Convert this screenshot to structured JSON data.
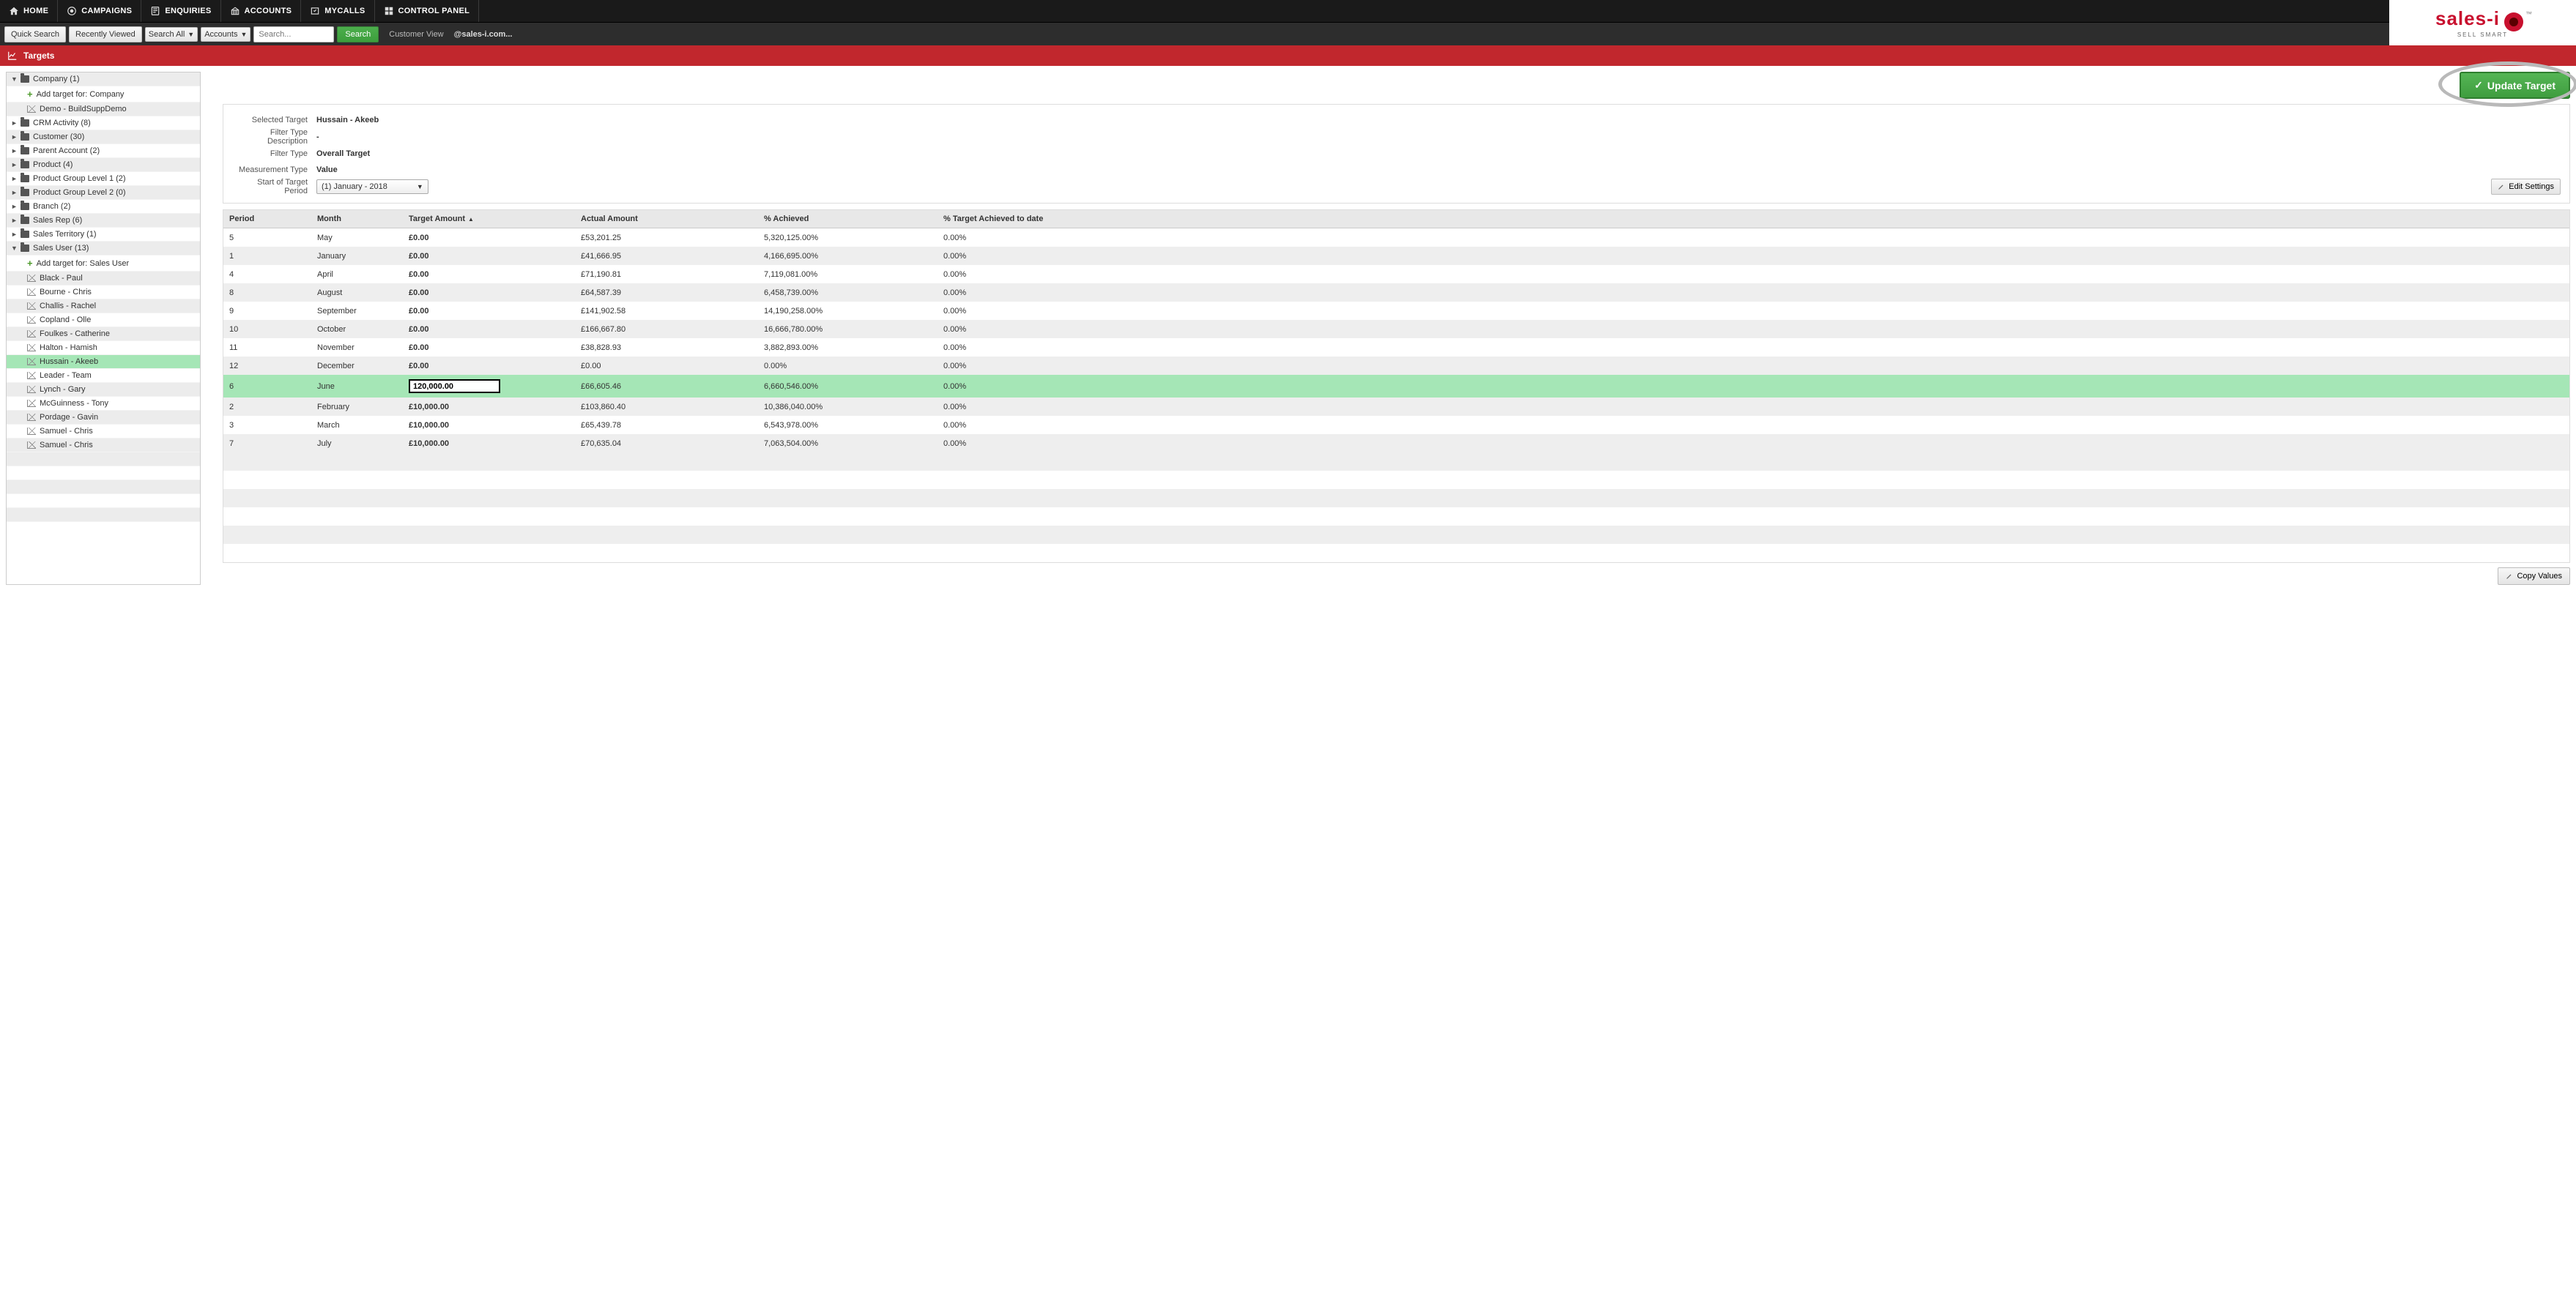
{
  "nav": {
    "items": [
      {
        "label": "HOME"
      },
      {
        "label": "CAMPAIGNS"
      },
      {
        "label": "ENQUIRIES"
      },
      {
        "label": "ACCOUNTS"
      },
      {
        "label": "MYCALLS"
      },
      {
        "label": "CONTROL PANEL"
      }
    ]
  },
  "logo": {
    "brand": "sales-i",
    "tagline": "SELL SMART"
  },
  "searchbar": {
    "quick": "Quick Search",
    "recent": "Recently Viewed",
    "scope": "Search All",
    "entity": "Accounts",
    "placeholder": "Search...",
    "search_btn": "Search",
    "customer_view": "Customer View",
    "domain": "@sales-i.com..."
  },
  "redbar": {
    "title": "Targets"
  },
  "update_target_btn": "Update Target",
  "tree": [
    {
      "type": "folder",
      "label": "Company (1)",
      "expand": "▼",
      "alt": true
    },
    {
      "type": "add",
      "label": "Add target for: Company",
      "indent": 1
    },
    {
      "type": "target",
      "label": "Demo - BuildSuppDemo",
      "indent": 1,
      "alt": true
    },
    {
      "type": "folder",
      "label": "CRM Activity (8)",
      "expand": "►"
    },
    {
      "type": "folder",
      "label": "Customer (30)",
      "expand": "►",
      "alt": true
    },
    {
      "type": "folder",
      "label": "Parent Account (2)",
      "expand": "►"
    },
    {
      "type": "folder",
      "label": "Product (4)",
      "expand": "►",
      "alt": true
    },
    {
      "type": "folder",
      "label": "Product Group Level 1 (2)",
      "expand": "►"
    },
    {
      "type": "folder",
      "label": "Product Group Level 2 (0)",
      "expand": "►",
      "alt": true
    },
    {
      "type": "folder",
      "label": "Branch (2)",
      "expand": "►"
    },
    {
      "type": "folder",
      "label": "Sales Rep (6)",
      "expand": "►",
      "alt": true
    },
    {
      "type": "folder",
      "label": "Sales Territory (1)",
      "expand": "►"
    },
    {
      "type": "folder",
      "label": "Sales User (13)",
      "expand": "▼",
      "alt": true
    },
    {
      "type": "add",
      "label": "Add target for: Sales User",
      "indent": 1
    },
    {
      "type": "target",
      "label": "Black - Paul",
      "indent": 1,
      "alt": true
    },
    {
      "type": "target",
      "label": "Bourne - Chris",
      "indent": 1
    },
    {
      "type": "target",
      "label": "Challis - Rachel",
      "indent": 1,
      "alt": true
    },
    {
      "type": "target",
      "label": "Copland - Olle",
      "indent": 1
    },
    {
      "type": "target",
      "label": "Foulkes - Catherine",
      "indent": 1,
      "alt": true
    },
    {
      "type": "target",
      "label": "Halton - Hamish",
      "indent": 1
    },
    {
      "type": "target",
      "label": "Hussain - Akeeb",
      "indent": 1,
      "selected": true
    },
    {
      "type": "target",
      "label": "Leader - Team",
      "indent": 1
    },
    {
      "type": "target",
      "label": "Lynch - Gary",
      "indent": 1,
      "alt": true
    },
    {
      "type": "target",
      "label": "McGuinness - Tony",
      "indent": 1
    },
    {
      "type": "target",
      "label": "Pordage - Gavin",
      "indent": 1,
      "alt": true
    },
    {
      "type": "target",
      "label": "Samuel - Chris",
      "indent": 1
    },
    {
      "type": "target",
      "label": "Samuel - Chris",
      "indent": 1,
      "alt": true
    }
  ],
  "info": {
    "selected_target_label": "Selected Target",
    "selected_target": "Hussain - Akeeb",
    "filter_desc_label": "Filter Type Description",
    "filter_desc": "-",
    "filter_type_label": "Filter Type",
    "filter_type": "Overall Target",
    "measurement_label": "Measurement Type",
    "measurement": "Value",
    "period_label": "Start of Target Period",
    "period": "(1) January - 2018",
    "edit_settings": "Edit Settings"
  },
  "table": {
    "headers": {
      "period": "Period",
      "month": "Month",
      "target": "Target Amount",
      "actual": "Actual Amount",
      "achieved": "% Achieved",
      "todate": "% Target Achieved to date"
    },
    "rows": [
      {
        "period": "5",
        "month": "May",
        "target": "£0.00",
        "actual": "£53,201.25",
        "achieved": "5,320,125.00%",
        "todate": "0.00%"
      },
      {
        "period": "1",
        "month": "January",
        "target": "£0.00",
        "actual": "£41,666.95",
        "achieved": "4,166,695.00%",
        "todate": "0.00%"
      },
      {
        "period": "4",
        "month": "April",
        "target": "£0.00",
        "actual": "£71,190.81",
        "achieved": "7,119,081.00%",
        "todate": "0.00%"
      },
      {
        "period": "8",
        "month": "August",
        "target": "£0.00",
        "actual": "£64,587.39",
        "achieved": "6,458,739.00%",
        "todate": "0.00%"
      },
      {
        "period": "9",
        "month": "September",
        "target": "£0.00",
        "actual": "£141,902.58",
        "achieved": "14,190,258.00%",
        "todate": "0.00%"
      },
      {
        "period": "10",
        "month": "October",
        "target": "£0.00",
        "actual": "£166,667.80",
        "achieved": "16,666,780.00%",
        "todate": "0.00%"
      },
      {
        "period": "11",
        "month": "November",
        "target": "£0.00",
        "actual": "£38,828.93",
        "achieved": "3,882,893.00%",
        "todate": "0.00%"
      },
      {
        "period": "12",
        "month": "December",
        "target": "£0.00",
        "actual": "£0.00",
        "achieved": "0.00%",
        "todate": "0.00%"
      },
      {
        "period": "6",
        "month": "June",
        "target_edit": "120,000.00",
        "actual": "£66,605.46",
        "achieved": "6,660,546.00%",
        "todate": "0.00%",
        "editing": true
      },
      {
        "period": "2",
        "month": "February",
        "target": "£10,000.00",
        "actual": "£103,860.40",
        "achieved": "10,386,040.00%",
        "todate": "0.00%"
      },
      {
        "period": "3",
        "month": "March",
        "target": "£10,000.00",
        "actual": "£65,439.78",
        "achieved": "6,543,978.00%",
        "todate": "0.00%"
      },
      {
        "period": "7",
        "month": "July",
        "target": "£10,000.00",
        "actual": "£70,635.04",
        "achieved": "7,063,504.00%",
        "todate": "0.00%"
      }
    ],
    "copy_values": "Copy Values"
  }
}
